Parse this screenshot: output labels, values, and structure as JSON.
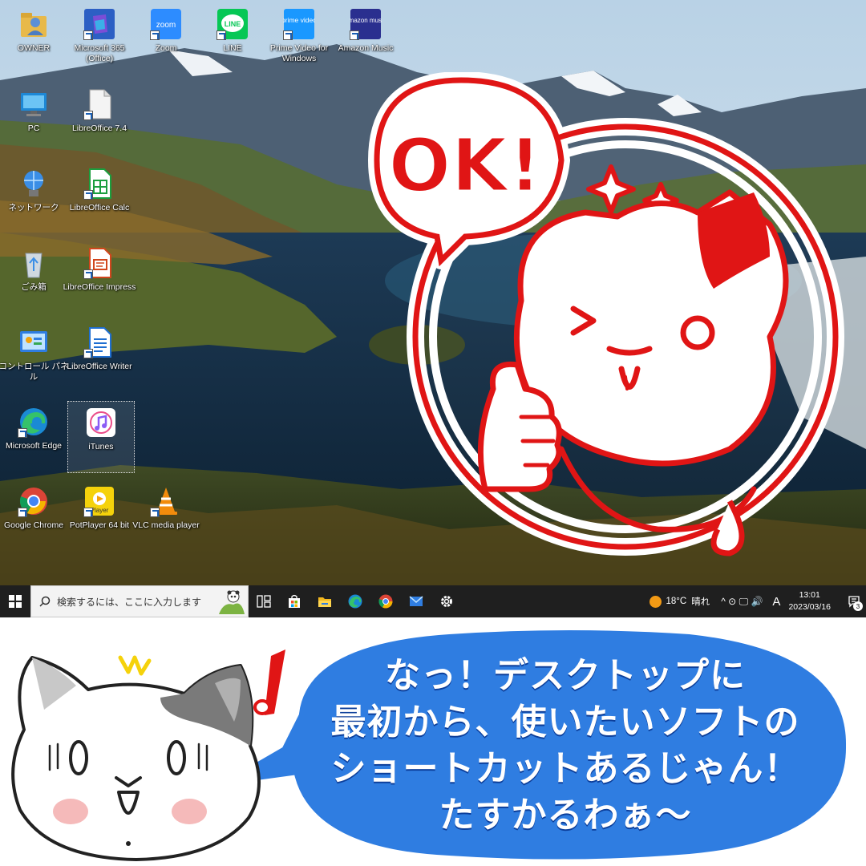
{
  "desktop": {
    "icons": [
      {
        "label": "OWNER",
        "icon": "user-folder-icon"
      },
      {
        "label": "Microsoft 365 (Office)",
        "icon": "microsoft-365-icon"
      },
      {
        "label": "Zoom",
        "icon": "zoom-icon",
        "glyph_text": "zoom"
      },
      {
        "label": "LINE",
        "icon": "line-icon",
        "glyph_text": "LINE"
      },
      {
        "label": "Prime Video for Windows",
        "icon": "prime-video-icon",
        "glyph_text": "prime video"
      },
      {
        "label": "Amazon Music",
        "icon": "amazon-music-icon",
        "glyph_text": "amazon music"
      },
      {
        "label": "PC",
        "icon": "pc-icon"
      },
      {
        "label": "LibreOffice 7.4",
        "icon": "libreoffice-icon"
      },
      {
        "label": "ネットワーク",
        "icon": "network-icon"
      },
      {
        "label": "LibreOffice Calc",
        "icon": "libreoffice-calc-icon"
      },
      {
        "label": "ごみ箱",
        "icon": "recycle-bin-icon"
      },
      {
        "label": "LibreOffice Impress",
        "icon": "libreoffice-impress-icon"
      },
      {
        "label": "コントロール パネル",
        "icon": "control-panel-icon"
      },
      {
        "label": "LibreOffice Writer",
        "icon": "libreoffice-writer-icon"
      },
      {
        "label": "Microsoft Edge",
        "icon": "edge-icon"
      },
      {
        "label": "iTunes",
        "icon": "itunes-icon"
      },
      {
        "label": "Google Chrome",
        "icon": "chrome-icon"
      },
      {
        "label": "PotPlayer 64 bit",
        "icon": "potplayer-icon",
        "glyph_text": "Player"
      },
      {
        "label": "VLC media player",
        "icon": "vlc-icon"
      }
    ]
  },
  "taskbar": {
    "search_placeholder": "検索するには、ここに入力します",
    "apps": [
      "task-view-icon",
      "store-icon",
      "file-explorer-icon",
      "edge-icon",
      "chrome-icon",
      "mail-icon",
      "settings-icon"
    ],
    "weather_temp": "18°C",
    "weather_text": "晴れ",
    "tray_symbols": "^ ⊙ 🖵 🔊",
    "ime": "A",
    "time": "13:01",
    "date": "2023/03/16",
    "notification_count": "3"
  },
  "stamp": {
    "text": "OK!",
    "color": "#e01515"
  },
  "banner": {
    "lines": [
      "なっ！デスクトップに",
      "最初から、使いたいソフトの",
      "ショートカットあるじゃん！",
      "たすかるわぁ〜"
    ],
    "bubble_color": "#2f7de1"
  }
}
